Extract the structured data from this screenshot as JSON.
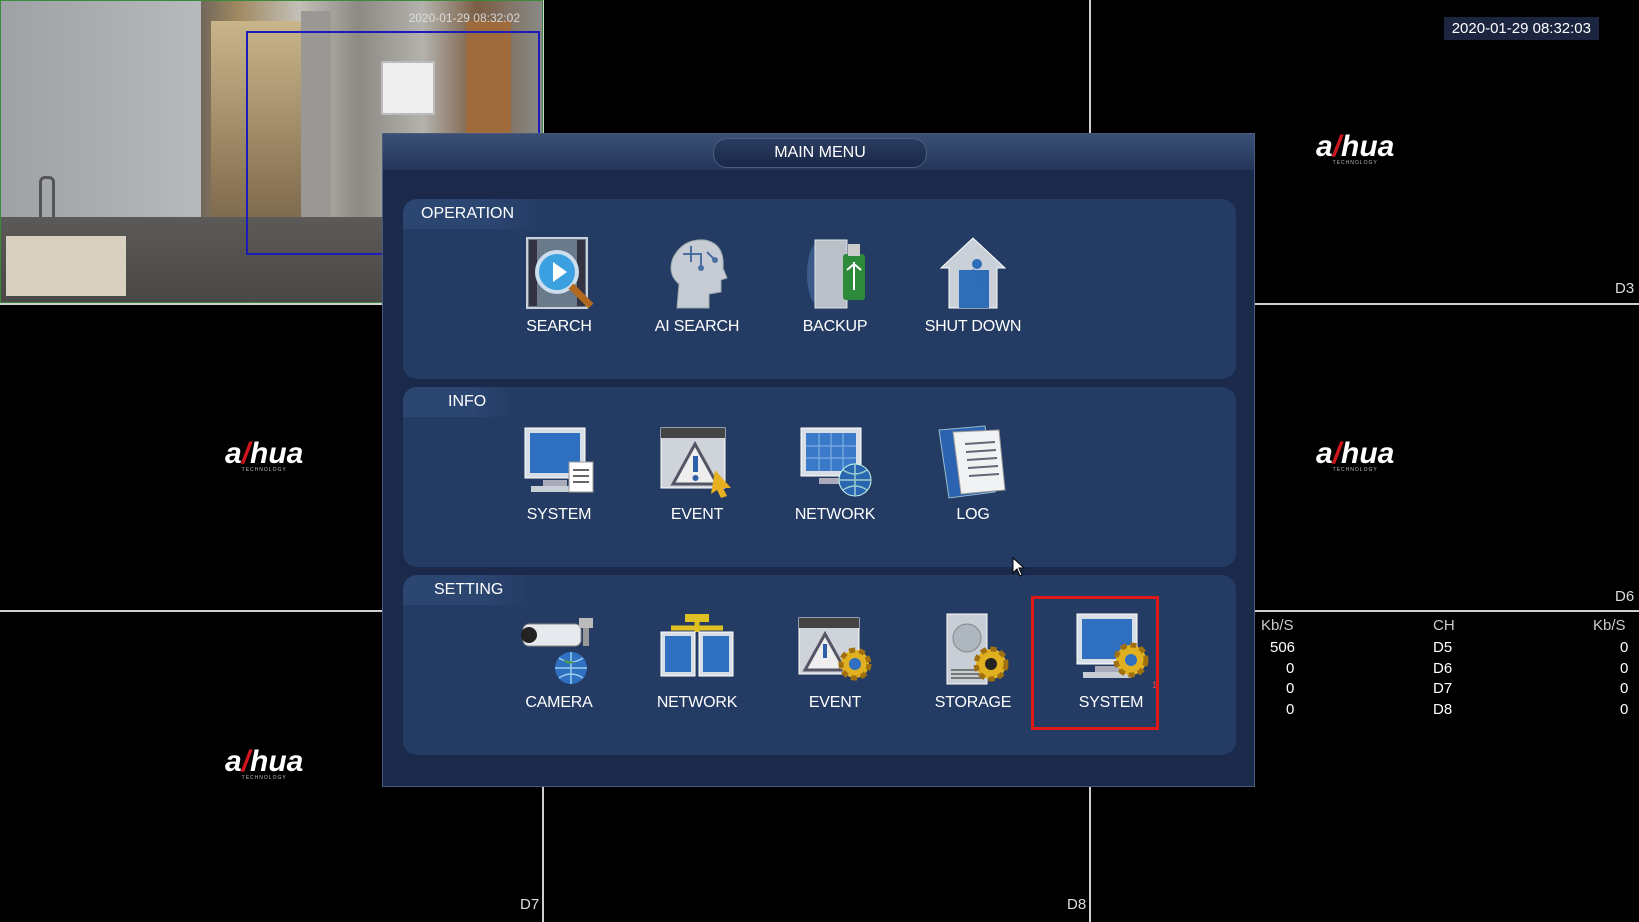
{
  "timestamp": "2020-01-29 08:32:03",
  "feed": {
    "timestamp": "2020-01-29 08:32:02"
  },
  "channel_labels": [
    "D3",
    "D6",
    "D7",
    "D8"
  ],
  "logo": {
    "brand": "a hua",
    "tagline": "TECHNOLOGY"
  },
  "menu": {
    "title": "MAIN MENU",
    "sections": [
      {
        "label": "OPERATION",
        "items": [
          {
            "label": "SEARCH",
            "icon": "search-icon"
          },
          {
            "label": "AI SEARCH",
            "icon": "ai-head-icon"
          },
          {
            "label": "BACKUP",
            "icon": "backup-usb-icon"
          },
          {
            "label": "SHUT DOWN",
            "icon": "shutdown-house-icon"
          }
        ]
      },
      {
        "label": "INFO",
        "items": [
          {
            "label": "SYSTEM",
            "icon": "monitor-info-icon"
          },
          {
            "label": "EVENT",
            "icon": "warning-window-icon"
          },
          {
            "label": "NETWORK",
            "icon": "network-globe-icon"
          },
          {
            "label": "LOG",
            "icon": "log-book-icon"
          }
        ]
      },
      {
        "label": "SETTING",
        "items": [
          {
            "label": "CAMERA",
            "icon": "camera-globe-icon"
          },
          {
            "label": "NETWORK",
            "icon": "network-monitors-icon"
          },
          {
            "label": "EVENT",
            "icon": "event-gear-icon"
          },
          {
            "label": "STORAGE",
            "icon": "storage-gear-icon"
          },
          {
            "label": "SYSTEM",
            "icon": "system-gear-icon",
            "badge": "1"
          }
        ]
      }
    ]
  },
  "stats": {
    "headers": [
      "Kb/S",
      "CH",
      "Kb/S"
    ],
    "rows": [
      [
        "506",
        "D5",
        "0"
      ],
      [
        "0",
        "D6",
        "0"
      ],
      [
        "0",
        "D7",
        "0"
      ],
      [
        "0",
        "D8",
        "0"
      ]
    ]
  },
  "colors": {
    "highlight": "#e01818",
    "menu_bg": "#1b2a4a",
    "section_bg": "#243b63"
  }
}
